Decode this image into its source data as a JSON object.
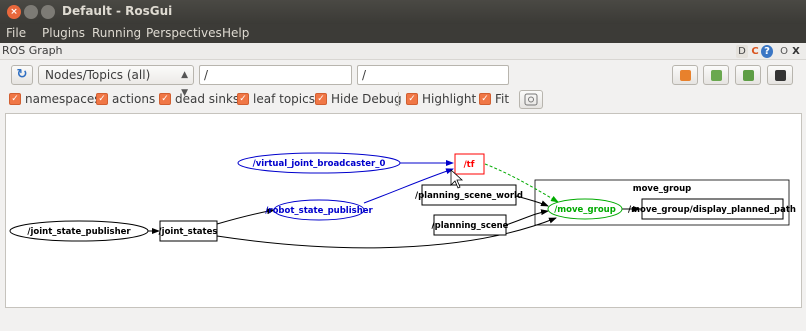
{
  "window": {
    "title": "Default - RosGui"
  },
  "menu": [
    "File",
    "Plugins",
    "Running",
    "Perspectives",
    "Help"
  ],
  "plugin": {
    "title": "ROS Graph",
    "header_icons": [
      "D",
      "C",
      "?",
      "O",
      "X"
    ]
  },
  "toolbar": {
    "refresh_icon": "refresh-icon",
    "mode_select": "Nodes/Topics (all)",
    "node_filter": "/",
    "topic_filter": "/",
    "buttons": [
      "load-dot-icon",
      "save-dot-icon",
      "save-svg-icon",
      "save-image-icon"
    ]
  },
  "options": [
    {
      "label": "namespaces",
      "checked": true
    },
    {
      "label": "actions",
      "checked": true
    },
    {
      "label": "dead sinks",
      "checked": true
    },
    {
      "label": "leaf topics",
      "checked": true
    },
    {
      "label": "Hide Debug",
      "checked": true
    },
    {
      "label": "Highlight",
      "checked": true
    },
    {
      "label": "Fit",
      "checked": true
    }
  ],
  "graph": {
    "nodes": {
      "joint_state_publisher": "/joint_state_publisher",
      "virtual_joint_broadcaster": "/virtual_joint_broadcaster_0",
      "robot_state_publisher": "/robot_state_publisher",
      "move_group": "/move_group"
    },
    "topics": {
      "joint_states": "/joint_states",
      "tf": "/tf",
      "planning_scene_world": "/planning_scene_world",
      "planning_scene": "/planning_scene",
      "display_planned_path": "/move_group/display_planned_path"
    },
    "namespace_label": "move_group",
    "colors": {
      "normal": "#000000",
      "highlight_in": "#0000cc",
      "highlight_out": "#00aa00",
      "selected": "#ff0000"
    }
  }
}
